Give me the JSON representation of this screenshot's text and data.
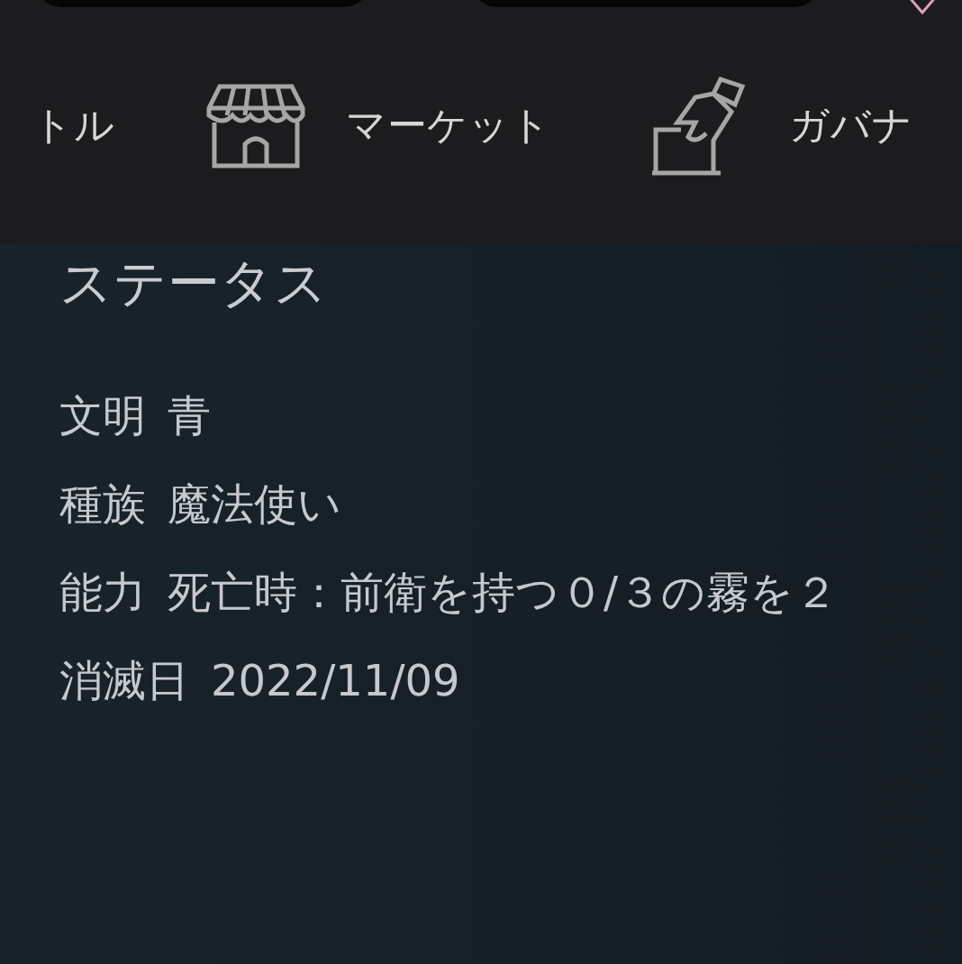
{
  "nav": [
    {
      "label": "トル",
      "kind": "text"
    },
    {
      "label": "マーケット",
      "kind": "shop"
    },
    {
      "label": "ガバナ",
      "kind": "vote"
    }
  ],
  "status": {
    "title": "ステータス",
    "rows": [
      {
        "label": "文明",
        "value": "青"
      },
      {
        "label": "種族",
        "value": "魔法使い"
      },
      {
        "label": "能力",
        "value": "死亡時：前衛を持つ０/３の霧を２"
      },
      {
        "label": "消滅日",
        "value": "2022/11/09"
      }
    ]
  }
}
